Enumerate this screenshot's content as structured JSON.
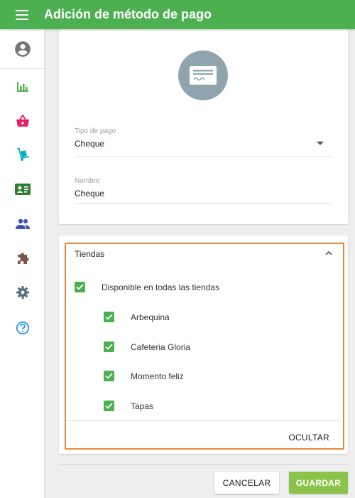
{
  "header": {
    "title": "Adición de método de pago",
    "menu_icon": "menu-icon"
  },
  "sidebar": {
    "items": [
      {
        "name": "account-circle-icon",
        "color": "#757575"
      },
      {
        "name": "bar-chart-icon",
        "color": "#4caf50"
      },
      {
        "name": "basket-icon",
        "color": "#e91e63"
      },
      {
        "name": "hand-truck-icon",
        "color": "#00acc1"
      },
      {
        "name": "contact-card-icon",
        "color": "#2e7d32"
      },
      {
        "name": "people-icon",
        "color": "#3f51b5"
      },
      {
        "name": "puzzle-icon",
        "color": "#795548"
      },
      {
        "name": "gear-icon",
        "color": "#546e7a"
      },
      {
        "name": "help-icon",
        "color": "#2196f3"
      }
    ]
  },
  "payment_form": {
    "icon": "cheque-icon",
    "type_field": {
      "label": "Tipo de pago",
      "value": "Cheque"
    },
    "name_field": {
      "label": "Nombre",
      "value": "Cheque"
    }
  },
  "stores": {
    "title": "Tiendas",
    "all_stores": {
      "label": "Disponible en todas las tiendas",
      "checked": true
    },
    "items": [
      {
        "label": "Arbequina",
        "checked": true
      },
      {
        "label": "Cafeteria Gloria",
        "checked": true
      },
      {
        "label": "Momento feliz",
        "checked": true
      },
      {
        "label": "Tapas",
        "checked": true
      }
    ],
    "hide_label": "OCULTAR"
  },
  "actions": {
    "cancel_label": "CANCELAR",
    "save_label": "GUARDAR"
  },
  "colors": {
    "primary": "#4caf50",
    "accent": "#8bc34a",
    "highlight": "#e8863a"
  }
}
